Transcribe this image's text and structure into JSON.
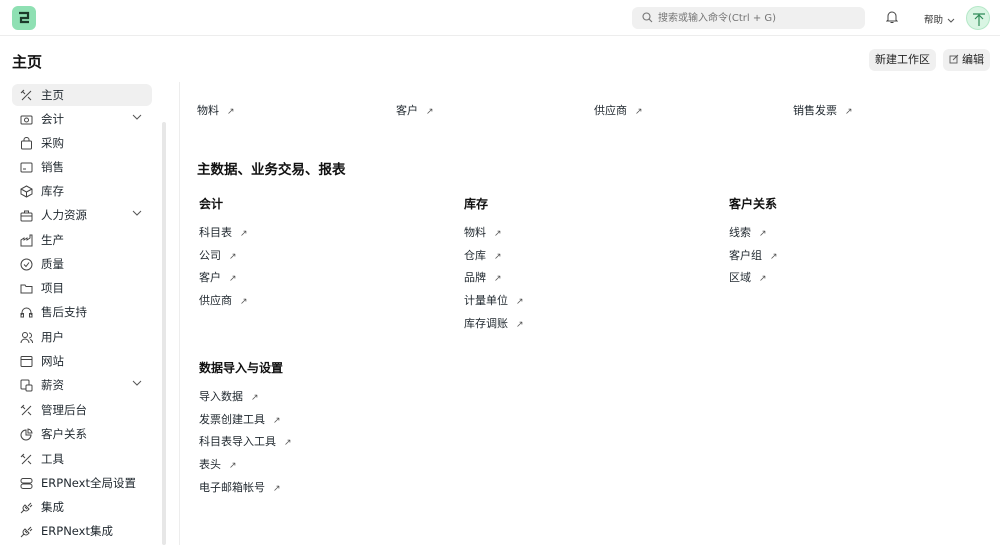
{
  "navbar": {
    "search_placeholder": "搜索或输入命令(Ctrl + G)",
    "help_label": "帮助"
  },
  "header": {
    "title": "主页",
    "new_workspace_label": "新建工作区",
    "edit_label": "编辑"
  },
  "sidebar": {
    "items": [
      {
        "label": "主页"
      },
      {
        "label": "会计"
      },
      {
        "label": "采购"
      },
      {
        "label": "销售"
      },
      {
        "label": "库存"
      },
      {
        "label": "人力资源"
      },
      {
        "label": "生产"
      },
      {
        "label": "质量"
      },
      {
        "label": "项目"
      },
      {
        "label": "售后支持"
      },
      {
        "label": "用户"
      },
      {
        "label": "网站"
      },
      {
        "label": "薪资"
      },
      {
        "label": "管理后台"
      },
      {
        "label": "客户关系"
      },
      {
        "label": "工具"
      },
      {
        "label": "ERPNext全局设置"
      },
      {
        "label": "集成"
      },
      {
        "label": "ERPNext集成"
      }
    ]
  },
  "quick_links": [
    "物料",
    "客户",
    "供应商",
    "销售发票"
  ],
  "section_master": {
    "title": "主数据、业务交易、报表",
    "columns": [
      {
        "title": "会计",
        "links": [
          "科目表",
          "公司",
          "客户",
          "供应商"
        ]
      },
      {
        "title": "库存",
        "links": [
          "物料",
          "仓库",
          "品牌",
          "计量单位",
          "库存调账"
        ]
      },
      {
        "title": "客户关系",
        "links": [
          "线索",
          "客户组",
          "区域"
        ]
      }
    ]
  },
  "section_import": {
    "title": "数据导入与设置",
    "links": [
      "导入数据",
      "发票创建工具",
      "科目表导入工具",
      "表头",
      "电子邮箱帐号"
    ]
  },
  "arrow_glyph": "↗"
}
